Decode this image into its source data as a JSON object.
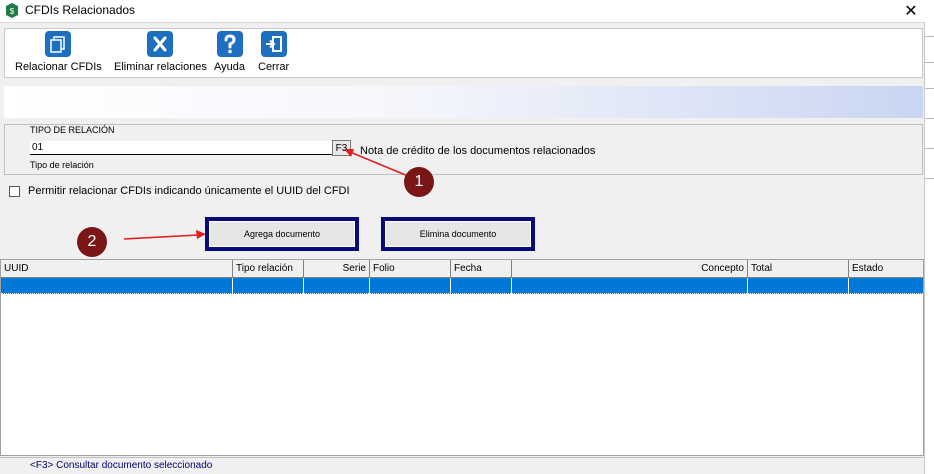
{
  "window": {
    "title": "CFDIs Relacionados",
    "close_glyph": "✕"
  },
  "toolbar": {
    "buttons": [
      {
        "label": "Relacionar CFDIs",
        "icon": "copy-documents-icon",
        "color": "#1e6fbf"
      },
      {
        "label": "Eliminar relaciones",
        "icon": "x-icon",
        "color": "#1e6fbf"
      },
      {
        "label": "Ayuda",
        "icon": "question-icon",
        "color": "#1e6fbf"
      },
      {
        "label": "Cerrar",
        "icon": "exit-door-icon",
        "color": "#1e6fbf"
      }
    ]
  },
  "relation": {
    "caption": "TIPO DE RELACIÓN",
    "value": "01",
    "f3_label": "F3",
    "description": "Nota de crédito de los documentos relacionados",
    "sub_label": "Tipo de relación"
  },
  "checkbox": {
    "label": "Permitir relacionar CFDIs indicando únicamente el UUID del CFDI",
    "checked": false
  },
  "actions": {
    "add_label": "Agrega documento",
    "remove_label": "Elimina documento"
  },
  "annotations": {
    "marker_1": "1",
    "marker_2": "2",
    "marker_color": "#7a1616",
    "arrow_color": "#e02020"
  },
  "table": {
    "columns": [
      "UUID",
      "Tipo relación",
      "Serie",
      "Folio",
      "Fecha",
      "Concepto",
      "Total",
      "Estado"
    ],
    "selected_row_color": "#0078d7"
  },
  "status": {
    "text": "<F3> Consultar documento seleccionado"
  }
}
